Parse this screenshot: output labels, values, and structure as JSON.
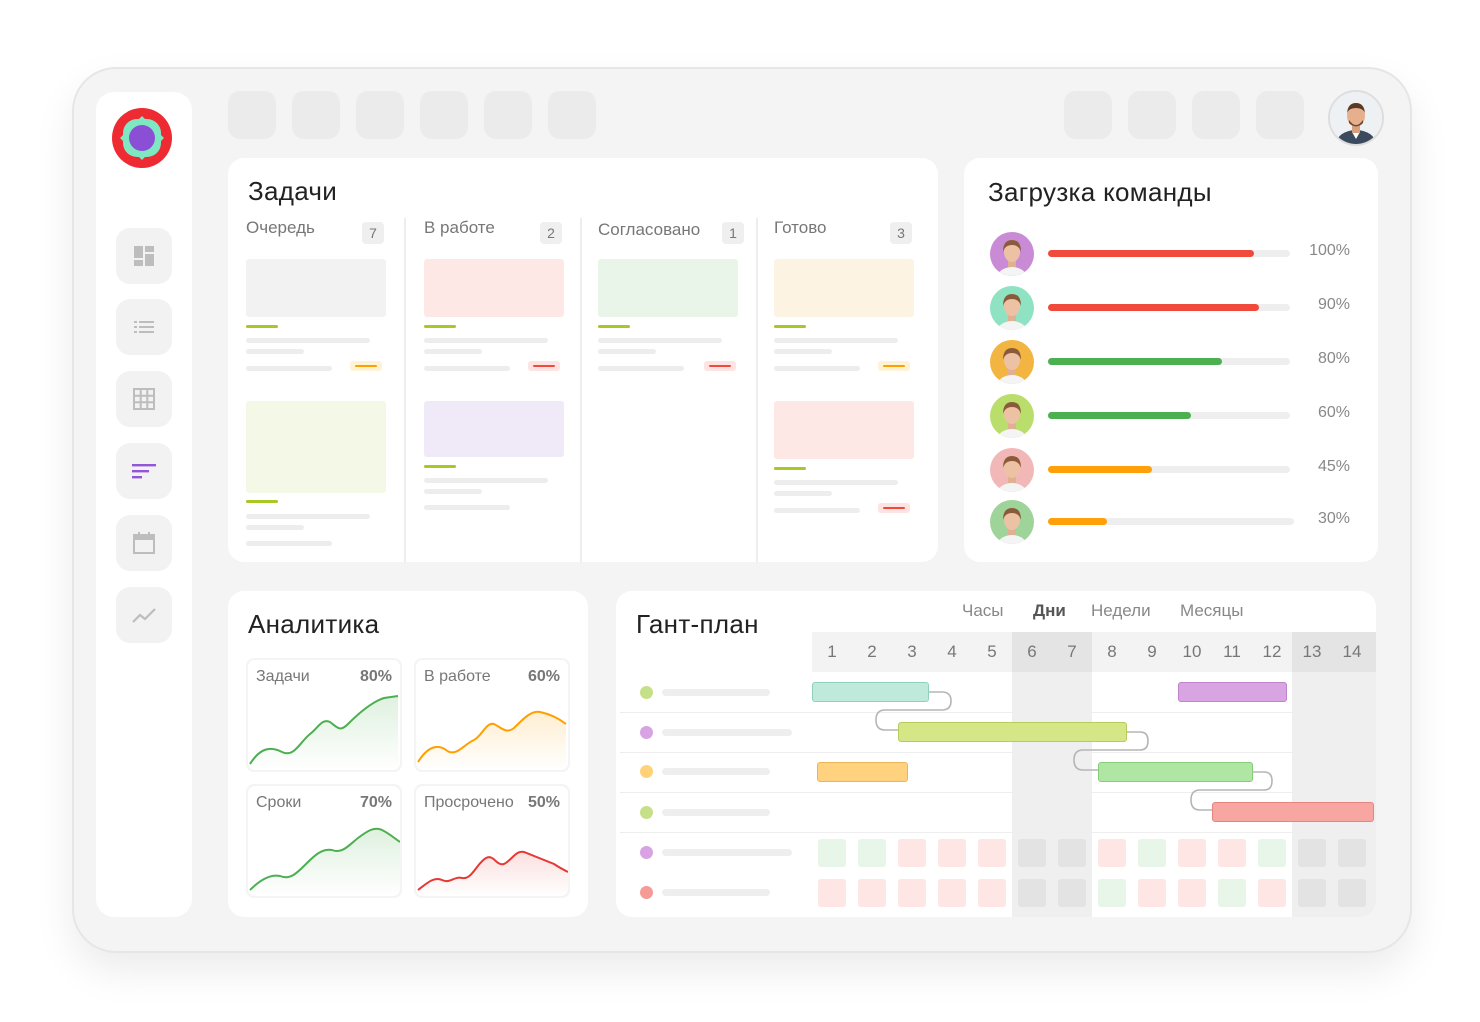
{
  "colors": {
    "accent": "#9256d6",
    "red": "#f04a3c",
    "green": "#4caf50",
    "orange": "#ff9f0a",
    "lime": "#a7c825"
  },
  "sidebar": {
    "logo": "app-logo",
    "items": [
      {
        "icon": "dashboard-icon",
        "active": false
      },
      {
        "icon": "list-icon",
        "active": false
      },
      {
        "icon": "table-icon",
        "active": false
      },
      {
        "icon": "gantt-icon",
        "active": true
      },
      {
        "icon": "calendar-icon",
        "active": false
      },
      {
        "icon": "chart-icon",
        "active": false
      }
    ]
  },
  "tasks": {
    "title": "Задачи",
    "columns": [
      {
        "title": "Очередь",
        "count": "7"
      },
      {
        "title": "В работе",
        "count": "2"
      },
      {
        "title": "Согласовано",
        "count": "1"
      },
      {
        "title": "Готово",
        "count": "3"
      }
    ]
  },
  "team": {
    "title": "Загрузка команды",
    "members": [
      {
        "pct_label": "100%",
        "load": 0.85,
        "color": "#f04a3c",
        "avatar_bg": "#c98bd6"
      },
      {
        "pct_label": "90%",
        "load": 0.87,
        "color": "#f04a3c",
        "avatar_bg": "#8fe3c3"
      },
      {
        "pct_label": "80%",
        "load": 0.72,
        "color": "#4caf50",
        "avatar_bg": "#f3b541"
      },
      {
        "pct_label": "60%",
        "load": 0.59,
        "color": "#4caf50",
        "avatar_bg": "#b9de6b"
      },
      {
        "pct_label": "45%",
        "load": 0.43,
        "color": "#ff9f0a",
        "avatar_bg": "#f2b8b8"
      },
      {
        "pct_label": "30%",
        "load": 0.24,
        "color": "#ff9f0a",
        "avatar_bg": "#9ed49a"
      }
    ]
  },
  "analytics": {
    "title": "Аналитика",
    "cards": [
      {
        "label": "Задачи",
        "value": "80%",
        "color": "#4caf50"
      },
      {
        "label": "В работе",
        "value": "60%",
        "color": "#ffa000"
      },
      {
        "label": "Сроки",
        "value": "70%",
        "color": "#4caf50"
      },
      {
        "label": "Просрочено",
        "value": "50%",
        "color": "#e53935"
      }
    ]
  },
  "gantt": {
    "title": "Гант-план",
    "tabs": [
      "Часы",
      "Дни",
      "Недели",
      "Месяцы"
    ],
    "active_tab": "Дни",
    "days": [
      "1",
      "2",
      "3",
      "4",
      "5",
      "6",
      "7",
      "8",
      "9",
      "10",
      "11",
      "12",
      "13",
      "14"
    ],
    "rows": [
      {
        "dot": "#c6e08a"
      },
      {
        "dot": "#d7a3e3"
      },
      {
        "dot": "#ffd27a"
      },
      {
        "dot": "#c6e08a"
      },
      {
        "dot": "#d7a3e3"
      },
      {
        "dot": "#f59a94"
      }
    ]
  }
}
